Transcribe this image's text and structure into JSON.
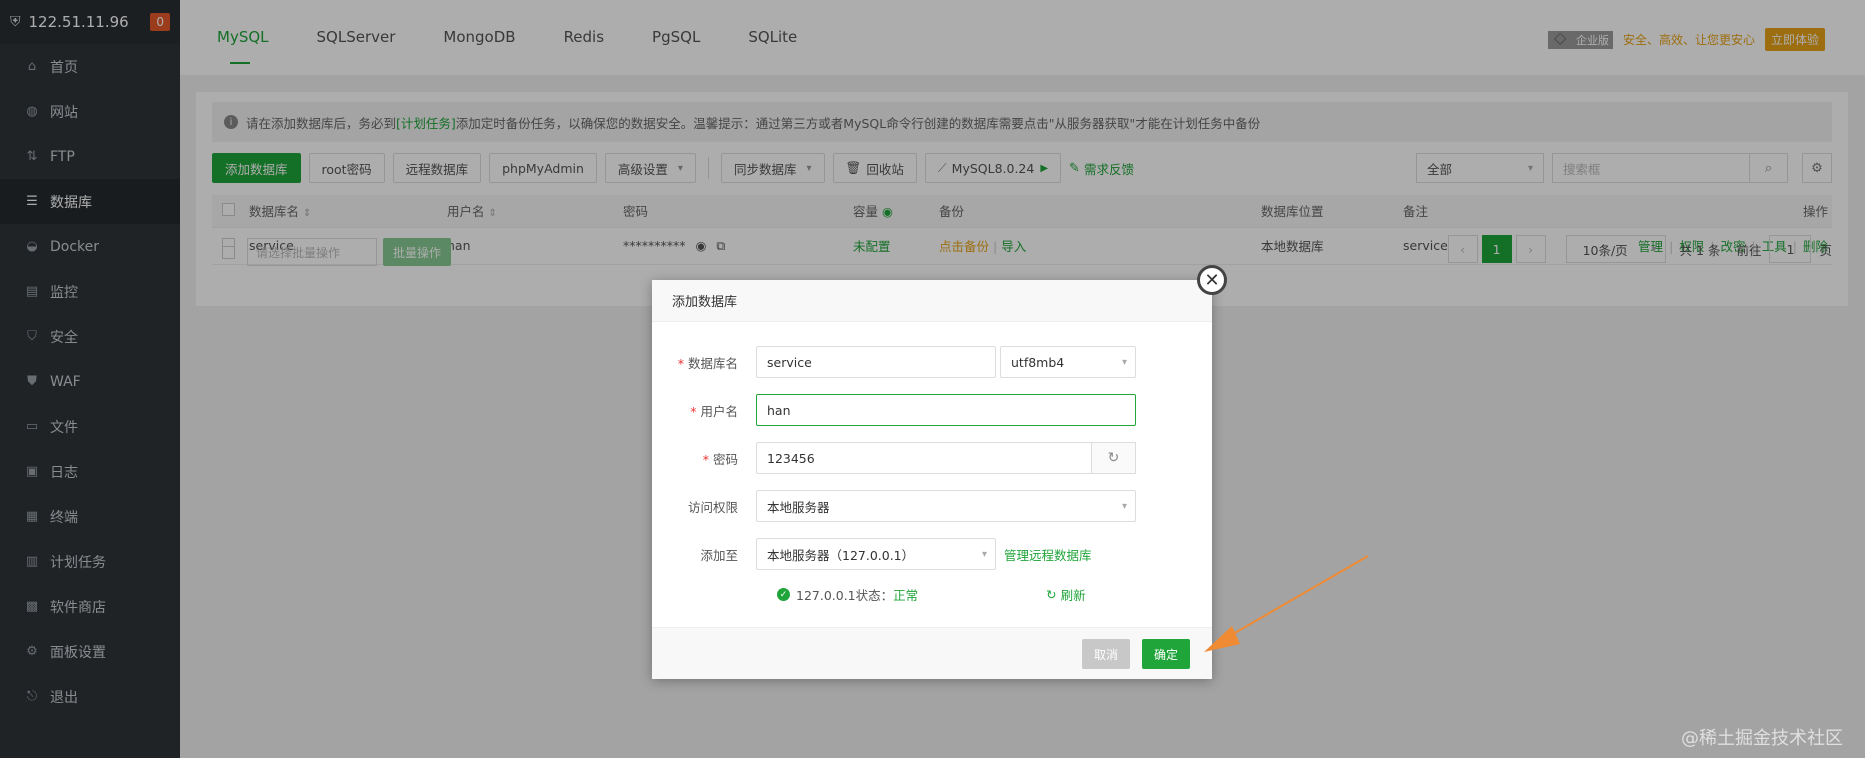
{
  "sidebar": {
    "ip": "122.51.11.96",
    "badge": "0",
    "items": [
      {
        "label": "首页",
        "icon": "home-icon"
      },
      {
        "label": "网站",
        "icon": "globe-icon"
      },
      {
        "label": "FTP",
        "icon": "ftp-icon"
      },
      {
        "label": "数据库",
        "icon": "database-icon"
      },
      {
        "label": "Docker",
        "icon": "docker-icon"
      },
      {
        "label": "监控",
        "icon": "monitor-icon"
      },
      {
        "label": "安全",
        "icon": "shield-icon"
      },
      {
        "label": "WAF",
        "icon": "waf-icon"
      },
      {
        "label": "文件",
        "icon": "folder-icon"
      },
      {
        "label": "日志",
        "icon": "log-icon"
      },
      {
        "label": "终端",
        "icon": "terminal-icon"
      },
      {
        "label": "计划任务",
        "icon": "calendar-icon"
      },
      {
        "label": "软件商店",
        "icon": "store-icon"
      },
      {
        "label": "面板设置",
        "icon": "settings-icon"
      },
      {
        "label": "退出",
        "icon": "logout-icon"
      }
    ]
  },
  "tabs": [
    "MySQL",
    "SQLServer",
    "MongoDB",
    "Redis",
    "PgSQL",
    "SQLite"
  ],
  "promo": {
    "edition": "企业版",
    "slogan": "安全、高效、让您更安心",
    "try": "立即体验"
  },
  "notice": {
    "pre": "请在添加数据库后，务必到",
    "link": "[计划任务]",
    "post": "添加定时备份任务，以确保您的数据安全。温馨提示：通过第三方或者MySQL命令行创建的数据库需要点击\"从服务器获取\"才能在计划任务中备份"
  },
  "toolbar": {
    "add": "添加数据库",
    "root_pwd": "root密码",
    "remote": "远程数据库",
    "phpmyadmin": "phpMyAdmin",
    "advanced": "高级设置",
    "sync": "同步数据库",
    "recycle": "回收站",
    "version": "MySQL8.0.24",
    "feedback": "需求反馈",
    "filter": "全部",
    "search_placeholder": "搜索框"
  },
  "table": {
    "headers": [
      "数据库名",
      "用户名",
      "密码",
      "容量",
      "备份",
      "数据库位置",
      "备注",
      "操作"
    ],
    "rows": [
      {
        "name": "service",
        "user": "han",
        "password": "**********",
        "capacity": "未配置",
        "backup": "点击备份",
        "import": "导入",
        "location": "本地数据库",
        "remark": "service",
        "ops": [
          "管理",
          "权限",
          "改密",
          "工具",
          "删除"
        ]
      }
    ]
  },
  "footer": {
    "batch_placeholder": "请选择批量操作",
    "batch_btn": "批量操作",
    "page": "1",
    "per_page": "10条/页",
    "total": "共 1 条",
    "goto_label": "前往",
    "goto_value": "1",
    "page_unit": "页"
  },
  "modal": {
    "title": "添加数据库",
    "db_name_label": "数据库名",
    "db_name": "service",
    "charset": "utf8mb4",
    "user_label": "用户名",
    "user": "han",
    "pwd_label": "密码",
    "pwd": "123456",
    "access_label": "访问权限",
    "access": "本地服务器",
    "add_to_label": "添加至",
    "add_to": "本地服务器（127.0.0.1）",
    "manage_remote": "管理远程数据库",
    "status_text": "127.0.0.1状态：",
    "status_value": "正常",
    "refresh": "刷新",
    "cancel": "取消",
    "confirm": "确定"
  },
  "watermark": "@稀土掘金技术社区",
  "colors": {
    "accent": "#20a53a",
    "sidebar": "#2f3439",
    "promo": "#e8a317",
    "arrow": "#f08a33"
  }
}
